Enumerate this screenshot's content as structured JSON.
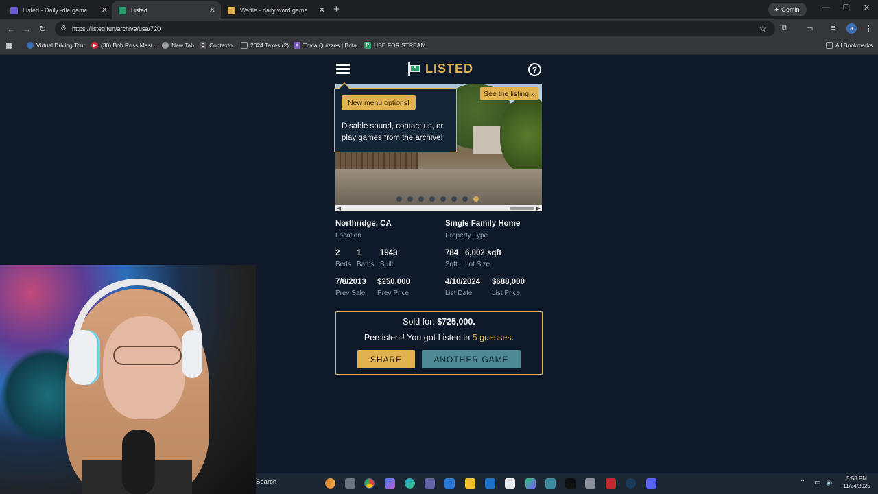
{
  "browser": {
    "tabs": [
      {
        "label": "Listed - Daily -dle game",
        "icon_color": "#6b5bd6"
      },
      {
        "label": "Listed",
        "icon_color": "#2a9e6a"
      },
      {
        "label": "Waffle - daily word game",
        "icon_color": "#e0b24f"
      }
    ],
    "gemini_label": "Gemini",
    "url": "https://listed.fun/archive/usa/720",
    "avatar_letter": "a",
    "bookmarks": [
      {
        "label": "Virtual Driving Tour",
        "icon_color": "#3b6fb6"
      },
      {
        "label": "(30) Bob Ross Mast...",
        "icon_color": "#e0263a"
      },
      {
        "label": "New Tab",
        "icon_color": "#9aa0a6"
      },
      {
        "label": "Contexto",
        "icon_color": "#555555"
      },
      {
        "label": "2024 Taxes (2)",
        "icon_color": "#9aa0a6"
      },
      {
        "label": "Trivia Quizzes | Brita...",
        "icon_color": "#7d5bbe"
      },
      {
        "label": "USE FOR STREAM",
        "icon_color": "#2a9e6a"
      }
    ],
    "all_bookmarks_label": "All Bookmarks"
  },
  "game": {
    "logo_text": "LISTED",
    "logo_sign": "$",
    "help_label": "?",
    "see_listing_label": "See the listing »",
    "popup": {
      "badge": "New menu options!",
      "body": "Disable sound, contact us, or play games from the archive!"
    },
    "photo_dots": {
      "count": 8,
      "active_index": 7
    },
    "details": {
      "location": {
        "value": "Northridge, CA",
        "label": "Location"
      },
      "property_type": {
        "value": "Single Family Home",
        "label": "Property Type"
      },
      "beds": {
        "value": "2",
        "label": "Beds"
      },
      "baths": {
        "value": "1",
        "label": "Baths"
      },
      "built": {
        "value": "1943",
        "label": "Built"
      },
      "sqft": {
        "value": "784",
        "label": "Sqft"
      },
      "lot_size": {
        "value": "6,002 sqft",
        "label": "Lot Size"
      },
      "prev_sale": {
        "value": "7/8/2013",
        "label": "Prev Sale"
      },
      "prev_price": {
        "value": "$250,000",
        "label": "Prev Price"
      },
      "list_date": {
        "value": "4/10/2024",
        "label": "List Date"
      },
      "list_price": {
        "value": "$688,000",
        "label": "List Price"
      }
    },
    "result": {
      "sold_prefix": "Sold for: ",
      "sold_value": "$725,000.",
      "message_prefix": "Persistent! You got Listed in ",
      "guesses": "5 guesses",
      "message_suffix": ".",
      "share_label": "SHARE",
      "another_label": "ANOTHER GAME"
    },
    "accent_color": "#e0b24f",
    "secondary_color": "#4e8a96",
    "background_color": "#0e1a2a"
  },
  "taskbar": {
    "search_label": "Search",
    "time": "5:58 PM",
    "date": "11/24/2025"
  }
}
